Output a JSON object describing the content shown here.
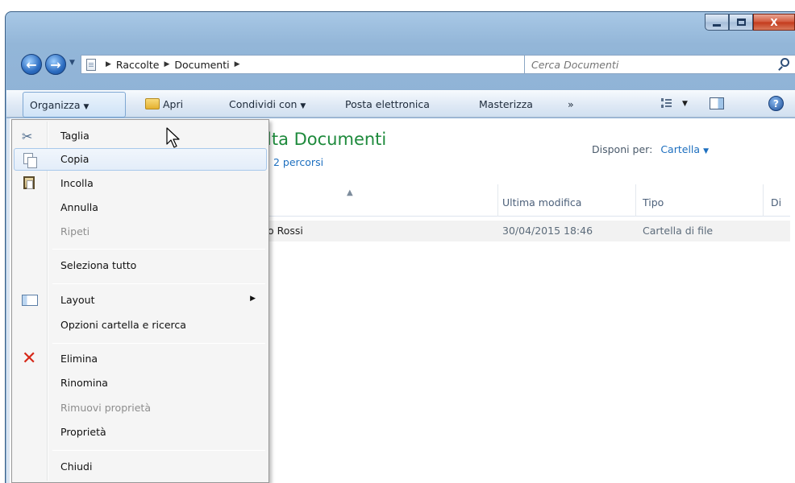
{
  "window": {
    "caption_buttons": [
      "minimize",
      "maximize",
      "close"
    ],
    "close_glyph": "X"
  },
  "address_bar": {
    "breadcrumbs": [
      "Raccolte",
      "Documenti"
    ],
    "search_placeholder": "Cerca Documenti"
  },
  "command_bar": {
    "organize": "Organizza",
    "open": "Apri",
    "share": "Condividi con",
    "email": "Posta elettronica",
    "burn": "Masterizza",
    "more": "»"
  },
  "library": {
    "title_visible": "lta Documenti",
    "subtitle_visible": "2 percorsi",
    "arrange_label": "Disponi per:",
    "arrange_value": "Cartella"
  },
  "columns": {
    "modified": "Ultima modifica",
    "type": "Tipo",
    "truncated": "Di"
  },
  "rows": [
    {
      "name_visible": "o Rossi",
      "modified": "30/04/2015 18:46",
      "type": "Cartella di file"
    }
  ],
  "menu": {
    "items": [
      {
        "label": "Taglia",
        "icon": "scissors-icon",
        "disabled": false
      },
      {
        "label": "Copia",
        "icon": "copy-icon",
        "disabled": false,
        "highlighted": true
      },
      {
        "label": "Incolla",
        "icon": "paste-icon",
        "disabled": false
      },
      {
        "label": "Annulla",
        "disabled": false
      },
      {
        "label": "Ripeti",
        "disabled": true
      },
      {
        "label": "Seleziona tutto",
        "disabled": false
      },
      {
        "label": "Layout",
        "icon": "layout-icon",
        "disabled": false,
        "submenu": true
      },
      {
        "label": "Opzioni cartella e ricerca",
        "disabled": false
      },
      {
        "label": "Elimina",
        "icon": "delete-icon",
        "disabled": false
      },
      {
        "label": "Rinomina",
        "disabled": false
      },
      {
        "label": "Rimuovi proprietà",
        "disabled": true
      },
      {
        "label": "Proprietà",
        "disabled": false
      },
      {
        "label": "Chiudi",
        "disabled": false
      }
    ]
  },
  "colors": {
    "library_title": "#1e8a3c",
    "link": "#1d6fbf",
    "delete": "#d62818"
  }
}
